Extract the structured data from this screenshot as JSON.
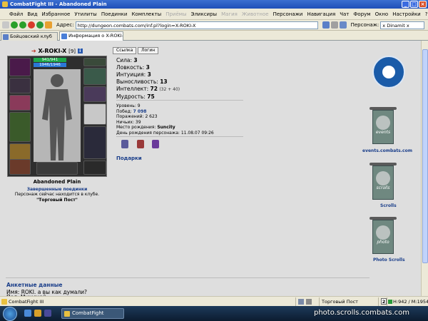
{
  "window": {
    "title": "CombatFight III - Abandoned Plain"
  },
  "menu": [
    "Файл",
    "Вид",
    "Избранное",
    "Утилиты",
    "Поединки",
    "Комплекты",
    "Приёмы",
    "Эликсиры",
    "Магия",
    "Животное",
    "Персонажи",
    "Навигация",
    "Чат",
    "Форум",
    "Окно",
    "Настройки",
    "?"
  ],
  "menu_disabled": [
    "Приёмы",
    "Магия",
    "Животное"
  ],
  "toolbar": {
    "address_label": "Адрес:",
    "address_value": "http://dungeon.combats.com/inf.pl?login=X-ROKI-X",
    "person_label": "Персонаж:",
    "person_value": "x Dinamit x"
  },
  "tabs": [
    {
      "label": "Бойцовский клуб",
      "active": false
    },
    {
      "label": "Информация о X-ROKI-X",
      "active": true
    }
  ],
  "character": {
    "arrow": "➔",
    "name": "X-ROKI-X",
    "level": "[9]",
    "info_icon": "i",
    "hp": "941/941",
    "mp": "1946/1946",
    "location": "Abandoned Plain",
    "fights_link": "Завершенные поединки",
    "club_status": "Персонаж сейчас находится в клубе.",
    "place": "\"Торговый Пост\""
  },
  "buttons": {
    "link": "Ссылка",
    "login": "Логин"
  },
  "stats": [
    {
      "label": "Сила:",
      "value": "3",
      "extra": ""
    },
    {
      "label": "Ловкость:",
      "value": "3",
      "extra": ""
    },
    {
      "label": "Интуиция:",
      "value": "3",
      "extra": ""
    },
    {
      "label": "Выносливость:",
      "value": "13",
      "extra": ""
    },
    {
      "label": "Интеллект:",
      "value": "72",
      "extra": "(32 + 40)"
    },
    {
      "label": "Мудрость:",
      "value": "75",
      "extra": ""
    }
  ],
  "info": {
    "level": {
      "label": "Уровень:",
      "value": "9"
    },
    "wins": {
      "label": "Побед:",
      "value": "7 098"
    },
    "losses": {
      "label": "Поражений:",
      "value": "2 623"
    },
    "draws": {
      "label": "Ничьих:",
      "value": "39"
    },
    "birthplace": {
      "label": "Место рождения:",
      "value": "Suncity"
    },
    "birthday": {
      "label": "День рождения персонажа:",
      "value": "11.08.07 09:26"
    }
  },
  "gifts_link": "Подарки",
  "sidebar": {
    "events_label": "events.combats.com",
    "scrolls_label": "Scrolls",
    "photo_label": "Photo Scrolls",
    "banner_words": [
      "events",
      "scrolls",
      "photo"
    ]
  },
  "questionnaire": {
    "title": "Анкетные данные",
    "name": "Имя: ROKI. а вы как думали?",
    "sex": "Пол: Мужской"
  },
  "status": {
    "app": "CombatFight III",
    "place": "Торговый Пост",
    "num": "2",
    "hm": "H:942 / M:1954"
  },
  "taskbar": {
    "task": "CombatFight"
  },
  "watermark": "photo.scrolls.combats.com",
  "colors": {
    "link_blue": "#1a3e8a",
    "hp": "#1fa84a",
    "mp": "#2a78d8",
    "crab": "#1a5ba8"
  }
}
